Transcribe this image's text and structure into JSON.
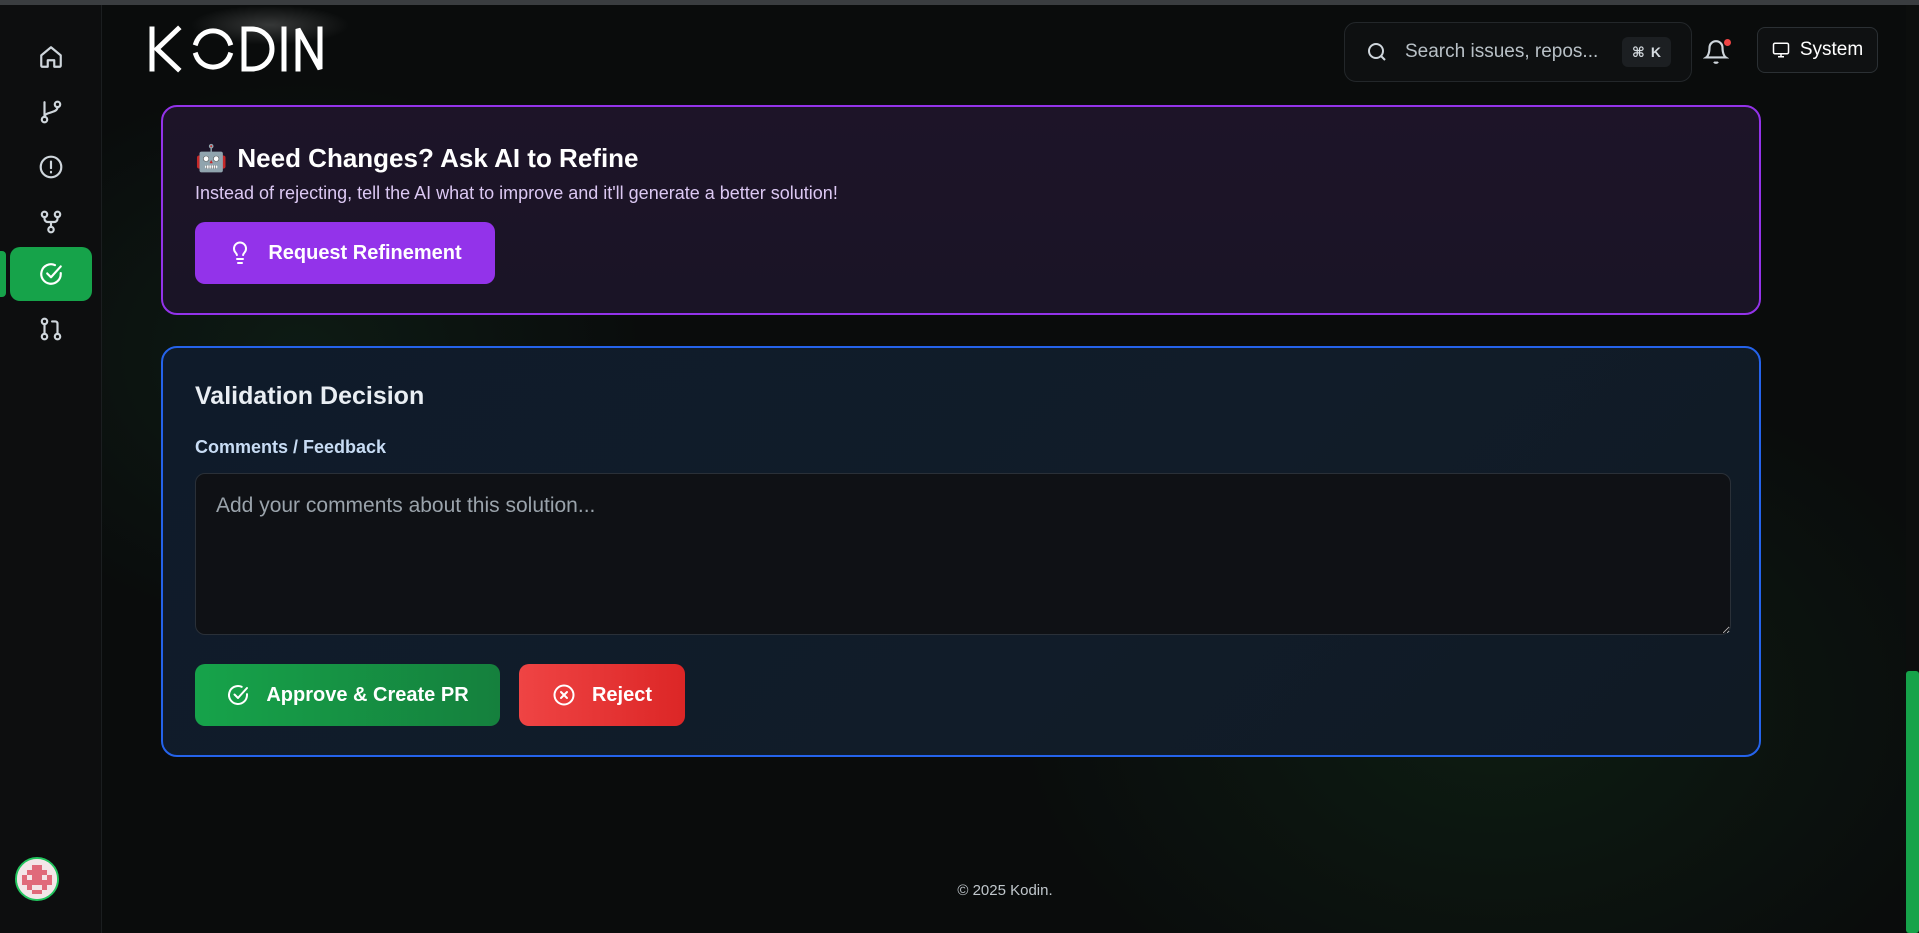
{
  "brand": {
    "logo_text": "KODIN"
  },
  "sidebar": {
    "items": [
      {
        "name": "home",
        "icon": "home-icon"
      },
      {
        "name": "branches",
        "icon": "git-branch-icon"
      },
      {
        "name": "issues",
        "icon": "alert-circle-icon"
      },
      {
        "name": "workflows",
        "icon": "git-fork-icon"
      },
      {
        "name": "validation",
        "icon": "check-circle-icon",
        "active": true
      },
      {
        "name": "pull-requests",
        "icon": "git-pull-request-icon"
      }
    ],
    "accent": "#16a34a"
  },
  "header": {
    "search_placeholder": "Search issues, repos...",
    "shortcut_symbol": "⌘",
    "shortcut_key": "K",
    "theme_label": "System"
  },
  "refine": {
    "emoji": "🤖",
    "title": "Need Changes? Ask AI to Refine",
    "description": "Instead of rejecting, tell the AI what to improve and it'll generate a better solution!",
    "button_label": "Request Refinement",
    "accent": "#9333ea"
  },
  "validation": {
    "title": "Validation Decision",
    "comments_label": "Comments / Feedback",
    "comments_placeholder": "Add your comments about this solution...",
    "comments_value": "",
    "approve_label": "Approve & Create PR",
    "reject_label": "Reject",
    "accent": "#2563eb"
  },
  "footer": {
    "copyright": "© 2025 Kodin."
  }
}
